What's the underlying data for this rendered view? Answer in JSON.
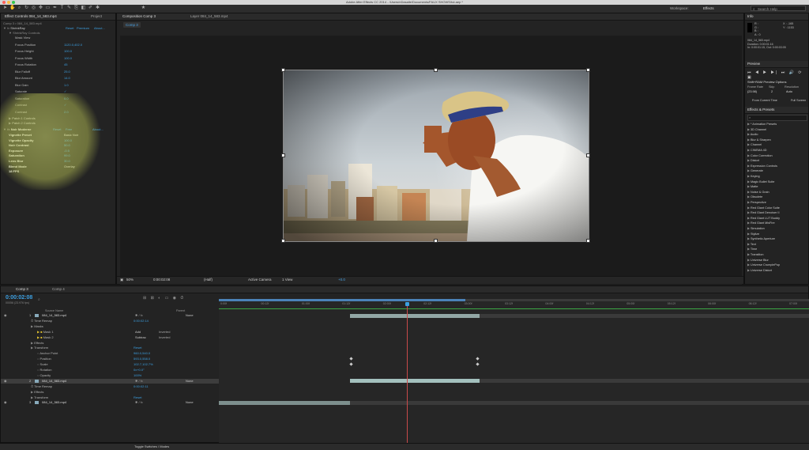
{
  "window": {
    "title": "Adobe After Effects CC 2014 - /Users/nDasalle/Documents/FAUX SHOWS/tut.aep *"
  },
  "toolbar": {
    "workspace_label": "Workspace:",
    "workspace_value": "Effects",
    "search_placeholder": "Search Help"
  },
  "project_panel": {
    "tabs": [
      "Effect Controls 084_14_583.mp4",
      "Project"
    ],
    "breadcrumb": "Comp 3 • 084_14_583.mp4",
    "shrinkray": {
      "name": "ShrinkRay",
      "links": [
        "Reset",
        "Premium",
        "About..."
      ],
      "group": "ShrinkRay Controls",
      "params": [
        {
          "label": "Mask View",
          "value": ""
        },
        {
          "label": "Focus Position",
          "value": "1120.0,402.0"
        },
        {
          "label": "Focus Height",
          "value": "100.0"
        },
        {
          "label": "Focus Width",
          "value": "100.0"
        },
        {
          "label": "Focus Rotation",
          "value": "45"
        },
        {
          "label": "Blur Falloff",
          "value": "25.0"
        },
        {
          "label": "Blur Amount",
          "value": "14.0"
        },
        {
          "label": "Blur Gain",
          "value": "1.0"
        },
        {
          "label": "Saturate",
          "value": "✓"
        },
        {
          "label": "Saturation",
          "value": "0.0"
        },
        {
          "label": "Contrast",
          "value": "✓"
        },
        {
          "label": "Contrast",
          "value": "2.0"
        }
      ],
      "patches": [
        "Patch 1 Controls",
        "Patch 2 Controls"
      ]
    },
    "noir": {
      "name": "Noir Moderne",
      "links": [
        "Reset",
        "Free",
        "About..."
      ],
      "params": [
        {
          "label": "Vignette Preset",
          "value": "Basic Noir"
        },
        {
          "label": "Vignette Opacity",
          "value": "100.0"
        },
        {
          "label": "Noir Contrast",
          "value": "50.0"
        },
        {
          "label": "Exposure",
          "value": "-0.5"
        },
        {
          "label": "Saturation",
          "value": "99.0"
        },
        {
          "label": "Lens Blur",
          "value": "30.0"
        },
        {
          "label": "Blend Mode",
          "value": "Overlay"
        },
        {
          "label": "18 FPS",
          "value": ""
        }
      ]
    }
  },
  "comp_panel": {
    "tabs": [
      "Composition Comp 3",
      "Layer 084_14_583.mp4"
    ],
    "subtab": "Comp 3",
    "footer": {
      "zoom": "50%",
      "timecode": "0:00:02:08",
      "resolution": "(Half)",
      "camera": "Active Camera",
      "view": "1 View",
      "exposure": "+0.0"
    }
  },
  "info_panel": {
    "title": "Info",
    "lines": [
      "R :",
      "G :",
      "B :",
      "A : 0"
    ],
    "coords": [
      "X : -165",
      "Y : 1153"
    ],
    "file": "084_14_583.mp4",
    "duration": "Duration: 0:00:01:16",
    "inout": "In: 0:00:01:15, Out: 0:00:03:05"
  },
  "preview_panel": {
    "title": "Preview",
    "options_title": "Shift+RAM Preview Options",
    "labels": [
      "Frame Rate",
      "Skip",
      "Resolution"
    ],
    "values": [
      "(23.98)",
      "2",
      "Auto"
    ],
    "buttons": [
      "From Current Time",
      "Full Screen"
    ]
  },
  "effects_panel": {
    "title": "Effects & Presets",
    "items": [
      "* Animation Presets",
      "3D Channel",
      "Audio",
      "Blur & Sharpen",
      "Channel",
      "CINEMA 4D",
      "Color Correction",
      "Distort",
      "Expression Controls",
      "Generate",
      "Keying",
      "Magic Bullet Suite",
      "Matte",
      "Noise & Grain",
      "Obsolete",
      "Perspective",
      "Red Giant Color Suite",
      "Red Giant Denoiser II",
      "Red Giant LUT Buddy",
      "Red Giant MisFire",
      "Simulation",
      "Stylize",
      "Synthetic Aperture",
      "Text",
      "Time",
      "Transition",
      "Universe Blur",
      "Universe CrumplePop",
      "Universe Distort"
    ]
  },
  "timeline": {
    "tabs": [
      "Comp 3",
      "Comp 4"
    ],
    "timecode": "0:00:02:08",
    "timecode_sub": "00056 (23.976 fps)",
    "columns": [
      "Source Name",
      "Parent"
    ],
    "ruler": [
      "0:00f",
      "00:12f",
      "01:00f",
      "01:12f",
      "02:00f",
      "02:12f",
      "03:00f",
      "03:12f",
      "04:00f",
      "04:12f",
      "05:00f",
      "05:12f",
      "06:00f",
      "06:12f",
      "07:00f"
    ],
    "layers": [
      {
        "indent": 0,
        "num": "1",
        "label": "084_14_583.mp4",
        "switch": "",
        "mode": "",
        "parent": "None",
        "kind": "layer"
      },
      {
        "indent": 1,
        "num": "",
        "label": "Time Remap",
        "switch": "",
        "mode": "0:00:02:14",
        "parent": "",
        "kind": "prop"
      },
      {
        "indent": 1,
        "num": "",
        "label": "Masks",
        "switch": "",
        "mode": "",
        "parent": "",
        "kind": "group"
      },
      {
        "indent": 2,
        "num": "",
        "label": "Mask 1",
        "switch": "Add",
        "mode": "Inverted",
        "parent": "",
        "kind": "mask"
      },
      {
        "indent": 2,
        "num": "",
        "label": "Mask 2",
        "switch": "Subtrac",
        "mode": "Inverted",
        "parent": "",
        "kind": "mask"
      },
      {
        "indent": 1,
        "num": "",
        "label": "Effects",
        "switch": "",
        "mode": "",
        "parent": "",
        "kind": "group"
      },
      {
        "indent": 1,
        "num": "",
        "label": "Transform",
        "switch": "",
        "mode": "Reset",
        "parent": "",
        "kind": "group"
      },
      {
        "indent": 2,
        "num": "",
        "label": "Anchor Point",
        "switch": "",
        "mode": "960.0,540.0",
        "parent": "",
        "kind": "prop"
      },
      {
        "indent": 2,
        "num": "",
        "label": "Position",
        "switch": "",
        "mode": "593.0,558.0",
        "parent": "",
        "kind": "prop"
      },
      {
        "indent": 2,
        "num": "",
        "label": "Scale",
        "switch": "",
        "mode": "102.7,102.7%",
        "parent": "",
        "kind": "prop"
      },
      {
        "indent": 2,
        "num": "",
        "label": "Rotation",
        "switch": "",
        "mode": "0x+0.0°",
        "parent": "",
        "kind": "prop"
      },
      {
        "indent": 2,
        "num": "",
        "label": "Opacity",
        "switch": "",
        "mode": "100%",
        "parent": "",
        "kind": "prop"
      },
      {
        "indent": 0,
        "num": "2",
        "label": "084_14_583.mp4",
        "switch": "",
        "mode": "",
        "parent": "None",
        "kind": "layer"
      },
      {
        "indent": 1,
        "num": "",
        "label": "Time Remap",
        "switch": "",
        "mode": "0:00:02:11",
        "parent": "",
        "kind": "prop"
      },
      {
        "indent": 1,
        "num": "",
        "label": "Effects",
        "switch": "",
        "mode": "",
        "parent": "",
        "kind": "group"
      },
      {
        "indent": 1,
        "num": "",
        "label": "Transform",
        "switch": "",
        "mode": "Reset",
        "parent": "",
        "kind": "group"
      },
      {
        "indent": 0,
        "num": "3",
        "label": "084_14_583.mp4",
        "switch": "",
        "mode": "",
        "parent": "None",
        "kind": "layer"
      }
    ]
  },
  "statusbar": {
    "toggle_label": "Toggle Switches / Modes"
  }
}
